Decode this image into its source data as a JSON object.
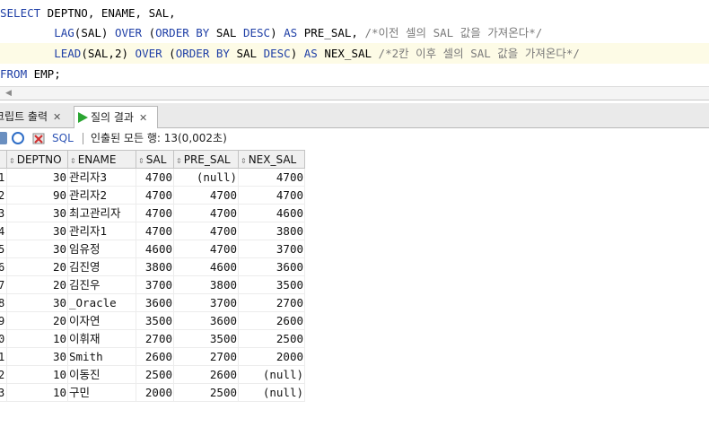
{
  "editor": {
    "lines": [
      {
        "parts": [
          {
            "t": "SELECT",
            "k": "kw"
          },
          {
            "t": " DEPTNO, ENAME, SAL,",
            "k": ""
          }
        ]
      },
      {
        "parts": [
          {
            "t": "        ",
            "k": ""
          },
          {
            "t": "LAG",
            "k": "kw"
          },
          {
            "t": "(SAL) ",
            "k": ""
          },
          {
            "t": "OVER",
            "k": "kw"
          },
          {
            "t": " (",
            "k": ""
          },
          {
            "t": "ORDER BY",
            "k": "kw"
          },
          {
            "t": " SAL ",
            "k": ""
          },
          {
            "t": "DESC",
            "k": "kw"
          },
          {
            "t": ") ",
            "k": ""
          },
          {
            "t": "AS",
            "k": "kw"
          },
          {
            "t": " PRE_SAL, ",
            "k": ""
          },
          {
            "t": "/*이전 셀의 SAL 값을 가져온다*/",
            "k": "cm"
          }
        ]
      },
      {
        "parts": [
          {
            "t": "        ",
            "k": ""
          },
          {
            "t": "LEAD",
            "k": "kw"
          },
          {
            "t": "(SAL,2) ",
            "k": ""
          },
          {
            "t": "OVER",
            "k": "kw"
          },
          {
            "t": " (",
            "k": ""
          },
          {
            "t": "ORDER BY",
            "k": "kw"
          },
          {
            "t": " SAL ",
            "k": ""
          },
          {
            "t": "DESC",
            "k": "kw"
          },
          {
            "t": ") ",
            "k": ""
          },
          {
            "t": "AS",
            "k": "kw"
          },
          {
            "t": " NEX_SAL ",
            "k": ""
          },
          {
            "t": "/*2칸 이후 셀의 SAL 값을 가져온다*/",
            "k": "cm"
          }
        ]
      },
      {
        "parts": [
          {
            "t": "FROM",
            "k": "kw"
          },
          {
            "t": " EMP;",
            "k": ""
          }
        ]
      }
    ]
  },
  "tabs": {
    "script_output": "크립트 출력",
    "query_result": "질의 결과"
  },
  "toolbar": {
    "sql_label": "SQL",
    "status": "인출된 모든 행: 13(0,002초)"
  },
  "grid": {
    "columns": [
      "DEPTNO",
      "ENAME",
      "SAL",
      "PRE_SAL",
      "NEX_SAL"
    ],
    "rows": [
      {
        "n": "1",
        "deptno": "30",
        "ename": "관리자3",
        "sal": "4700",
        "pre_sal": "(null)",
        "nex_sal": "4700"
      },
      {
        "n": "2",
        "deptno": "90",
        "ename": "관리자2",
        "sal": "4700",
        "pre_sal": "4700",
        "nex_sal": "4700"
      },
      {
        "n": "3",
        "deptno": "30",
        "ename": "최고관리자",
        "sal": "4700",
        "pre_sal": "4700",
        "nex_sal": "4600"
      },
      {
        "n": "4",
        "deptno": "30",
        "ename": "관리자1",
        "sal": "4700",
        "pre_sal": "4700",
        "nex_sal": "3800"
      },
      {
        "n": "5",
        "deptno": "30",
        "ename": "임유정",
        "sal": "4600",
        "pre_sal": "4700",
        "nex_sal": "3700"
      },
      {
        "n": "6",
        "deptno": "20",
        "ename": "김진영",
        "sal": "3800",
        "pre_sal": "4600",
        "nex_sal": "3600"
      },
      {
        "n": "7",
        "deptno": "20",
        "ename": "김진우",
        "sal": "3700",
        "pre_sal": "3800",
        "nex_sal": "3500"
      },
      {
        "n": "8",
        "deptno": "30",
        "ename": "_Oracle",
        "sal": "3600",
        "pre_sal": "3700",
        "nex_sal": "2700"
      },
      {
        "n": "9",
        "deptno": "20",
        "ename": "이자연",
        "sal": "3500",
        "pre_sal": "3600",
        "nex_sal": "2600"
      },
      {
        "n": "0",
        "deptno": "10",
        "ename": "이휘재",
        "sal": "2700",
        "pre_sal": "3500",
        "nex_sal": "2500"
      },
      {
        "n": "1",
        "deptno": "30",
        "ename": "Smith",
        "sal": "2600",
        "pre_sal": "2700",
        "nex_sal": "2000"
      },
      {
        "n": "2",
        "deptno": "10",
        "ename": "이동진",
        "sal": "2500",
        "pre_sal": "2600",
        "nex_sal": "(null)"
      },
      {
        "n": "3",
        "deptno": "10",
        "ename": "구민",
        "sal": "2000",
        "pre_sal": "2500",
        "nex_sal": "(null)"
      }
    ]
  }
}
